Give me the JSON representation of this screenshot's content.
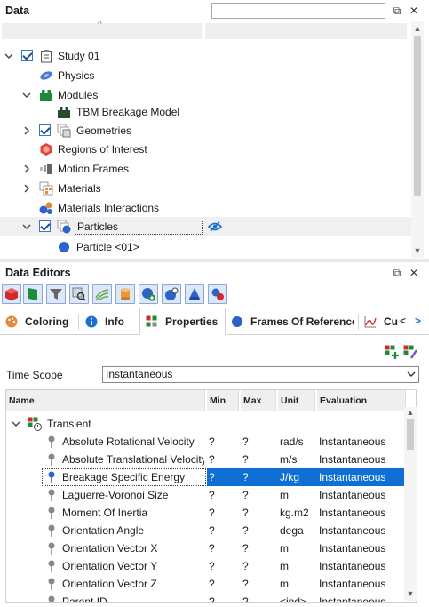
{
  "data_panel": {
    "title": "Data",
    "search_placeholder": "",
    "float_icon": "⧉",
    "close_icon": "✕",
    "sort_icon": "^",
    "tree": [
      {
        "label": "Study 01",
        "expanded": true,
        "checked": true
      },
      {
        "label": "Physics"
      },
      {
        "label": "Modules",
        "expanded": true
      },
      {
        "label": "TBM Breakage Model"
      },
      {
        "label": "Geometries",
        "expanded": false,
        "checked": true
      },
      {
        "label": "Regions of Interest"
      },
      {
        "label": "Motion Frames",
        "expanded": false
      },
      {
        "label": "Materials",
        "expanded": false
      },
      {
        "label": "Materials Interactions"
      },
      {
        "label": "Particles",
        "expanded": true,
        "checked": true,
        "selected": true
      },
      {
        "label": "Particle <01>"
      }
    ],
    "visibility_icon": "eye-slash-icon"
  },
  "editors_panel": {
    "title": "Data Editors",
    "float_icon": "⧉",
    "close_icon": "✕",
    "toolbar_icons": [
      "red-cube-icon",
      "green-flag-icon",
      "funnel-icon",
      "zoom-box-icon",
      "streamlines-icon",
      "cylinder-icon",
      "add-particle-icon",
      "sphere-gear-icon",
      "cone-icon",
      "link-icon"
    ],
    "tabs": [
      {
        "label": "Coloring",
        "icon": "palette-icon"
      },
      {
        "label": "Info",
        "icon": "info-icon"
      },
      {
        "label": "Properties",
        "icon": "properties-icon",
        "active": true
      },
      {
        "label": "Frames Of Reference",
        "icon": "frame-icon"
      },
      {
        "label": "Cu",
        "icon": "curve-icon"
      }
    ],
    "tab_prev": "<",
    "tab_next": ">",
    "time_scope_label": "Time Scope",
    "time_scope_value": "Instantaneous",
    "grid": {
      "columns": [
        "Name",
        "Min",
        "Max",
        "Unit",
        "Evaluation"
      ],
      "group_label": "Transient",
      "rows": [
        {
          "name": "Absolute Rotational Velocity",
          "min": "?",
          "max": "?",
          "unit": "rad/s",
          "eval": "Instantaneous"
        },
        {
          "name": "Absolute Translational Velocity",
          "min": "?",
          "max": "?",
          "unit": "m/s",
          "eval": "Instantaneous"
        },
        {
          "name": "Breakage Specific Energy",
          "min": "?",
          "max": "?",
          "unit": "J/kg",
          "eval": "Instantaneous",
          "selected": true
        },
        {
          "name": "Laguerre-Voronoi Size",
          "min": "?",
          "max": "?",
          "unit": "m",
          "eval": "Instantaneous"
        },
        {
          "name": "Moment Of Inertia",
          "min": "?",
          "max": "?",
          "unit": "kg.m2",
          "eval": "Instantaneous"
        },
        {
          "name": "Orientation Angle",
          "min": "?",
          "max": "?",
          "unit": "dega",
          "eval": "Instantaneous"
        },
        {
          "name": "Orientation Vector X",
          "min": "?",
          "max": "?",
          "unit": "m",
          "eval": "Instantaneous"
        },
        {
          "name": "Orientation Vector Y",
          "min": "?",
          "max": "?",
          "unit": "m",
          "eval": "Instantaneous"
        },
        {
          "name": "Orientation Vector Z",
          "min": "?",
          "max": "?",
          "unit": "m",
          "eval": "Instantaneous"
        },
        {
          "name": "Parent ID",
          "min": "?",
          "max": "?",
          "unit": "<ind>",
          "eval": "Instantaneous"
        }
      ]
    }
  },
  "colors": {
    "accent": "#0f6fd4",
    "selection_blue": "#0f6fd4",
    "tool_button_bg": "#dce8fa"
  }
}
